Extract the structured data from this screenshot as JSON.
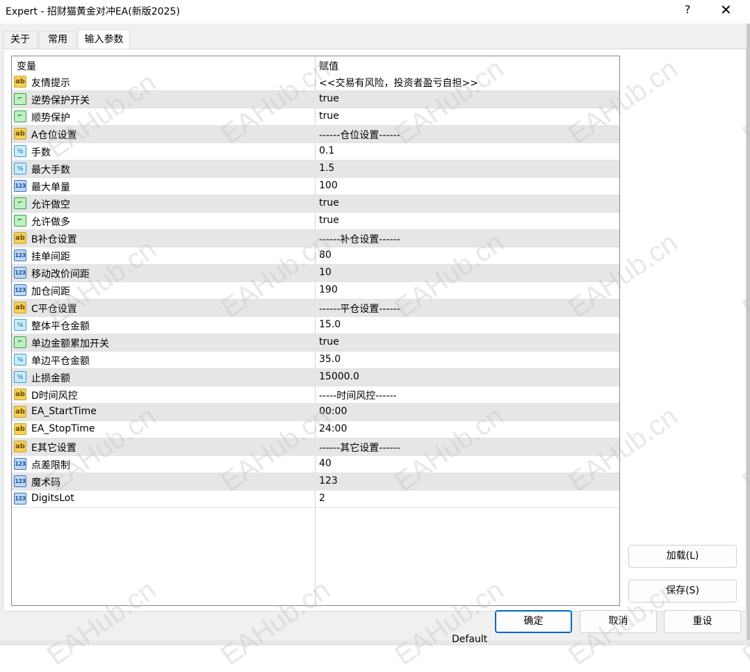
{
  "window": {
    "title": "Expert - 招财猫黄金对冲EA(新版2025)",
    "help_label": "?",
    "close_label": "✕"
  },
  "tabs": [
    {
      "label": "关于",
      "active": false
    },
    {
      "label": "常用",
      "active": false
    },
    {
      "label": "输入参数",
      "active": true
    }
  ],
  "grid": {
    "headers": {
      "variable": "变量",
      "value": "赋值"
    },
    "rows": [
      {
        "icon": "ab",
        "name": "友情提示",
        "value": "<<交易有风险，投资者盈亏自担>>"
      },
      {
        "icon": "bool",
        "name": "逆势保护开关",
        "value": "true"
      },
      {
        "icon": "bool",
        "name": "顺势保护",
        "value": "true"
      },
      {
        "icon": "ab",
        "name": "A仓位设置",
        "value": "------仓位设置------"
      },
      {
        "icon": "dbl",
        "name": "手数",
        "value": "0.1"
      },
      {
        "icon": "dbl",
        "name": "最大手数",
        "value": "1.5"
      },
      {
        "icon": "int",
        "name": "最大单量",
        "value": "100"
      },
      {
        "icon": "bool",
        "name": "允许做空",
        "value": "true"
      },
      {
        "icon": "bool",
        "name": "允许做多",
        "value": "true"
      },
      {
        "icon": "ab",
        "name": "B补仓设置",
        "value": "------补仓设置------"
      },
      {
        "icon": "int",
        "name": "挂单间距",
        "value": "80"
      },
      {
        "icon": "int",
        "name": "移动改价间距",
        "value": "10"
      },
      {
        "icon": "int",
        "name": "加仓间距",
        "value": "190"
      },
      {
        "icon": "ab",
        "name": "C平仓设置",
        "value": "------平仓设置------"
      },
      {
        "icon": "dbl",
        "name": "整体平仓金额",
        "value": "15.0"
      },
      {
        "icon": "bool",
        "name": "单边金额累加开关",
        "value": "true"
      },
      {
        "icon": "dbl",
        "name": "单边平仓金额",
        "value": "35.0"
      },
      {
        "icon": "dbl",
        "name": "止损金额",
        "value": "15000.0"
      },
      {
        "icon": "ab",
        "name": "D时间风控",
        "value": "-----时间风控------"
      },
      {
        "icon": "ab",
        "name": "EA_StartTime",
        "value": "00:00"
      },
      {
        "icon": "ab",
        "name": "EA_StopTime",
        "value": "24:00"
      },
      {
        "icon": "ab",
        "name": "E其它设置",
        "value": "------其它设置------"
      },
      {
        "icon": "int",
        "name": "点差限制",
        "value": "40"
      },
      {
        "icon": "int",
        "name": "魔术码",
        "value": "123"
      },
      {
        "icon": "int",
        "name": "DigitsLot",
        "value": "2"
      }
    ]
  },
  "icon_glyphs": {
    "ab": "ab",
    "bool": "⌐",
    "dbl": "½",
    "int": "123"
  },
  "buttons": {
    "load": "加载(L)",
    "save": "保存(S)",
    "ok": "确定",
    "cancel": "取消",
    "reset": "重设"
  },
  "background_text": {
    "default": "Default"
  },
  "watermark": "EAHub.cn",
  "colors": {
    "accent": "#0067c0",
    "alt_row": "#e6e6e6"
  }
}
